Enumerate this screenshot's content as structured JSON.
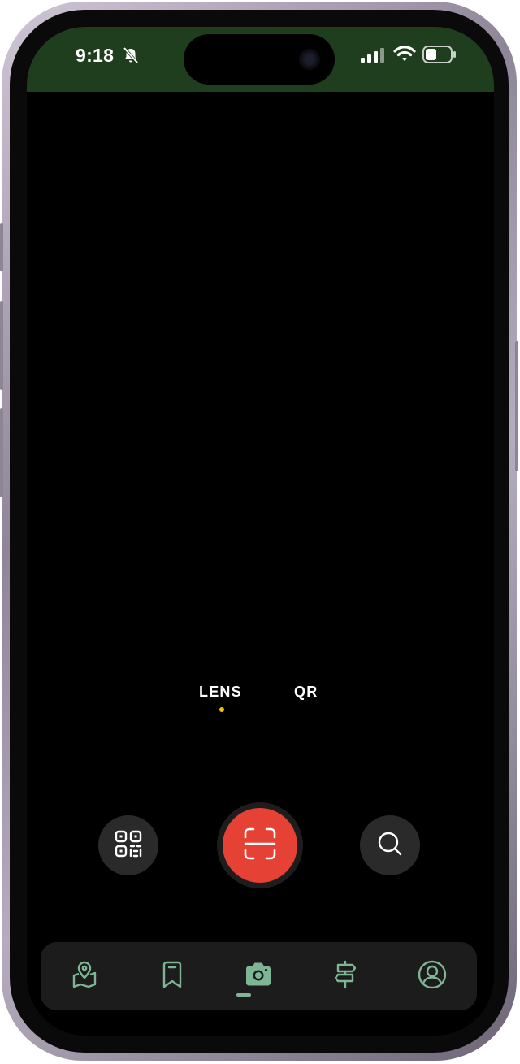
{
  "status_bar": {
    "time": "9:18",
    "background": "#1e3e1e",
    "icons": [
      "bell-slash-icon",
      "signal-icon",
      "wifi-icon",
      "battery-icon"
    ]
  },
  "camera": {
    "modes": [
      {
        "label": "LENS",
        "active": true
      },
      {
        "label": "QR",
        "active": false
      }
    ],
    "active_indicator_color": "#f2c300",
    "controls": {
      "left": "qr-code-icon",
      "center": "scan-frame-icon",
      "right": "search-icon"
    },
    "shutter_color": "#e54134"
  },
  "tab_bar": {
    "accent": "#7eb594",
    "items": [
      {
        "icon": "map-pin-icon",
        "active": false
      },
      {
        "icon": "bookmark-icon",
        "active": false
      },
      {
        "icon": "camera-icon",
        "active": true
      },
      {
        "icon": "signpost-icon",
        "active": false
      },
      {
        "icon": "profile-icon",
        "active": false
      }
    ]
  }
}
